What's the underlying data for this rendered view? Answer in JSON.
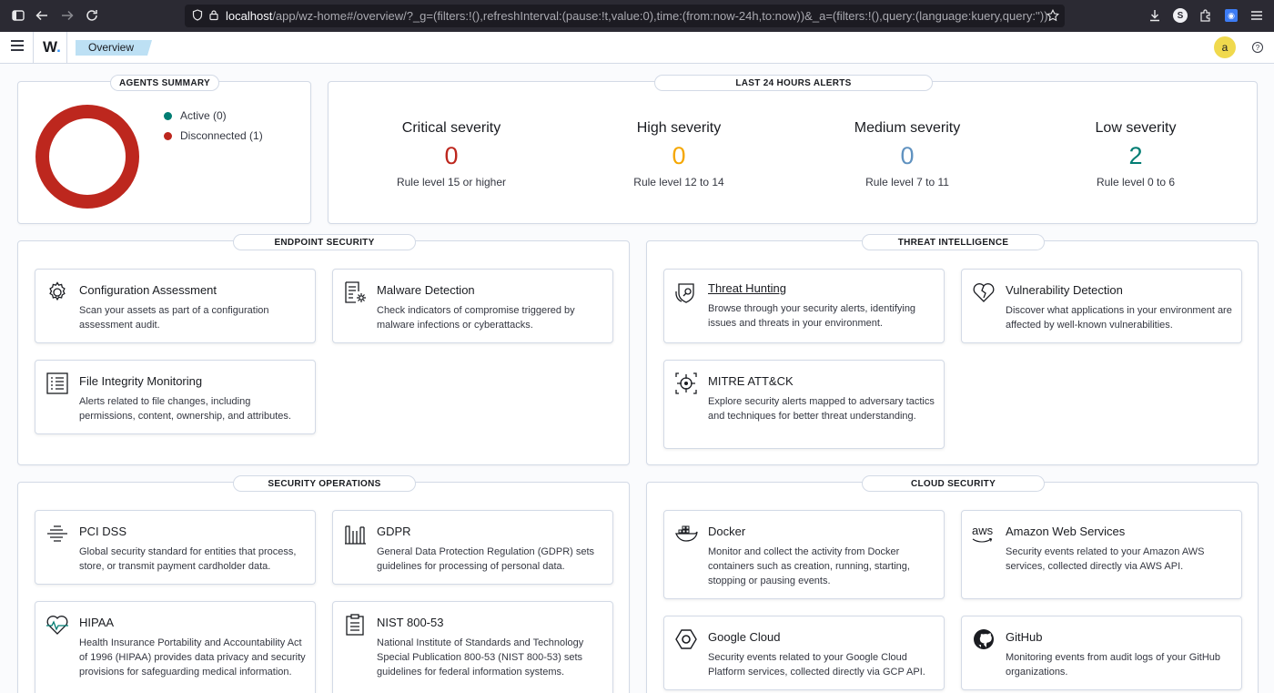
{
  "browser": {
    "url_host": "localhost",
    "url_path": "/app/wz-home#/overview/?_g=(filters:!(),refreshInterval:(pause:!t,value:0),time:(from:now-24h,to:now))&_a=(filters:!(),query:(language:kuery,query:''))"
  },
  "header": {
    "logo": "W",
    "logo_dot": ".",
    "breadcrumb": "Overview",
    "avatar": "a"
  },
  "agents_summary": {
    "title": "AGENTS SUMMARY",
    "legend": [
      {
        "label": "Active (0)",
        "color": "#017d73"
      },
      {
        "label": "Disconnected (1)",
        "color": "#bd271e"
      }
    ],
    "donut_color": "#bd271e"
  },
  "alerts": {
    "title": "LAST 24 HOURS ALERTS",
    "items": [
      {
        "label": "Critical severity",
        "value": "0",
        "sub": "Rule level 15 or higher",
        "color": "#bd271e"
      },
      {
        "label": "High severity",
        "value": "0",
        "sub": "Rule level 12 to 14",
        "color": "#f5a700"
      },
      {
        "label": "Medium severity",
        "value": "0",
        "sub": "Rule level 7 to 11",
        "color": "#6092c0"
      },
      {
        "label": "Low severity",
        "value": "2",
        "sub": "Rule level 0 to 6",
        "color": "#017d73"
      }
    ]
  },
  "endpoint": {
    "title": "ENDPOINT SECURITY",
    "cards": [
      {
        "title": "Configuration Assessment",
        "desc": "Scan your assets as part of a configuration assessment audit.",
        "icon": "gear-icon"
      },
      {
        "title": "Malware Detection",
        "desc": "Check indicators of compromise triggered by malware infections or cyberattacks.",
        "icon": "document-gear-icon"
      },
      {
        "title": "File Integrity Monitoring",
        "desc": "Alerts related to file changes, including permissions, content, ownership, and attributes.",
        "icon": "list-document-icon"
      }
    ]
  },
  "threat": {
    "title": "THREAT INTELLIGENCE",
    "cards": [
      {
        "title": "Threat Hunting",
        "desc": "Browse through your security alerts, identifying issues and threats in your environment.",
        "icon": "shield-search-icon"
      },
      {
        "title": "Vulnerability Detection",
        "desc": "Discover what applications in your environment are affected by well-known vulnerabilities.",
        "icon": "heart-broken-icon"
      },
      {
        "title": "MITRE ATT&CK",
        "desc": "Explore security alerts mapped to adversary tactics and techniques for better threat understanding.",
        "icon": "crosshair-icon"
      }
    ]
  },
  "secops": {
    "title": "SECURITY OPERATIONS",
    "cards": [
      {
        "title": "PCI DSS",
        "desc": "Global security standard for entities that process, store, or transmit payment cardholder data.",
        "icon": "lines-icon"
      },
      {
        "title": "GDPR",
        "desc": "General Data Protection Regulation (GDPR) sets guidelines for processing of personal data.",
        "icon": "building-icon"
      },
      {
        "title": "HIPAA",
        "desc": "Health Insurance Portability and Accountability Act of 1996 (HIPAA) provides data privacy and security provisions for safeguarding medical information.",
        "icon": "heartbeat-icon"
      },
      {
        "title": "NIST 800-53",
        "desc": "National Institute of Standards and Technology Special Publication 800-53 (NIST 800-53) sets guidelines for federal information systems.",
        "icon": "clipboard-icon"
      }
    ]
  },
  "cloud": {
    "title": "CLOUD SECURITY",
    "cards": [
      {
        "title": "Docker",
        "desc": "Monitor and collect the activity from Docker containers such as creation, running, starting, stopping or pausing events.",
        "icon": "docker-icon"
      },
      {
        "title": "Amazon Web Services",
        "desc": "Security events related to your Amazon AWS services, collected directly via AWS API.",
        "icon": "aws-icon",
        "icon_text": "aws"
      },
      {
        "title": "Google Cloud",
        "desc": "Security events related to your Google Cloud Platform services, collected directly via GCP API.",
        "icon": "google-cloud-icon"
      },
      {
        "title": "GitHub",
        "desc": "Monitoring events from audit logs of your GitHub organizations.",
        "icon": "github-icon"
      }
    ]
  }
}
